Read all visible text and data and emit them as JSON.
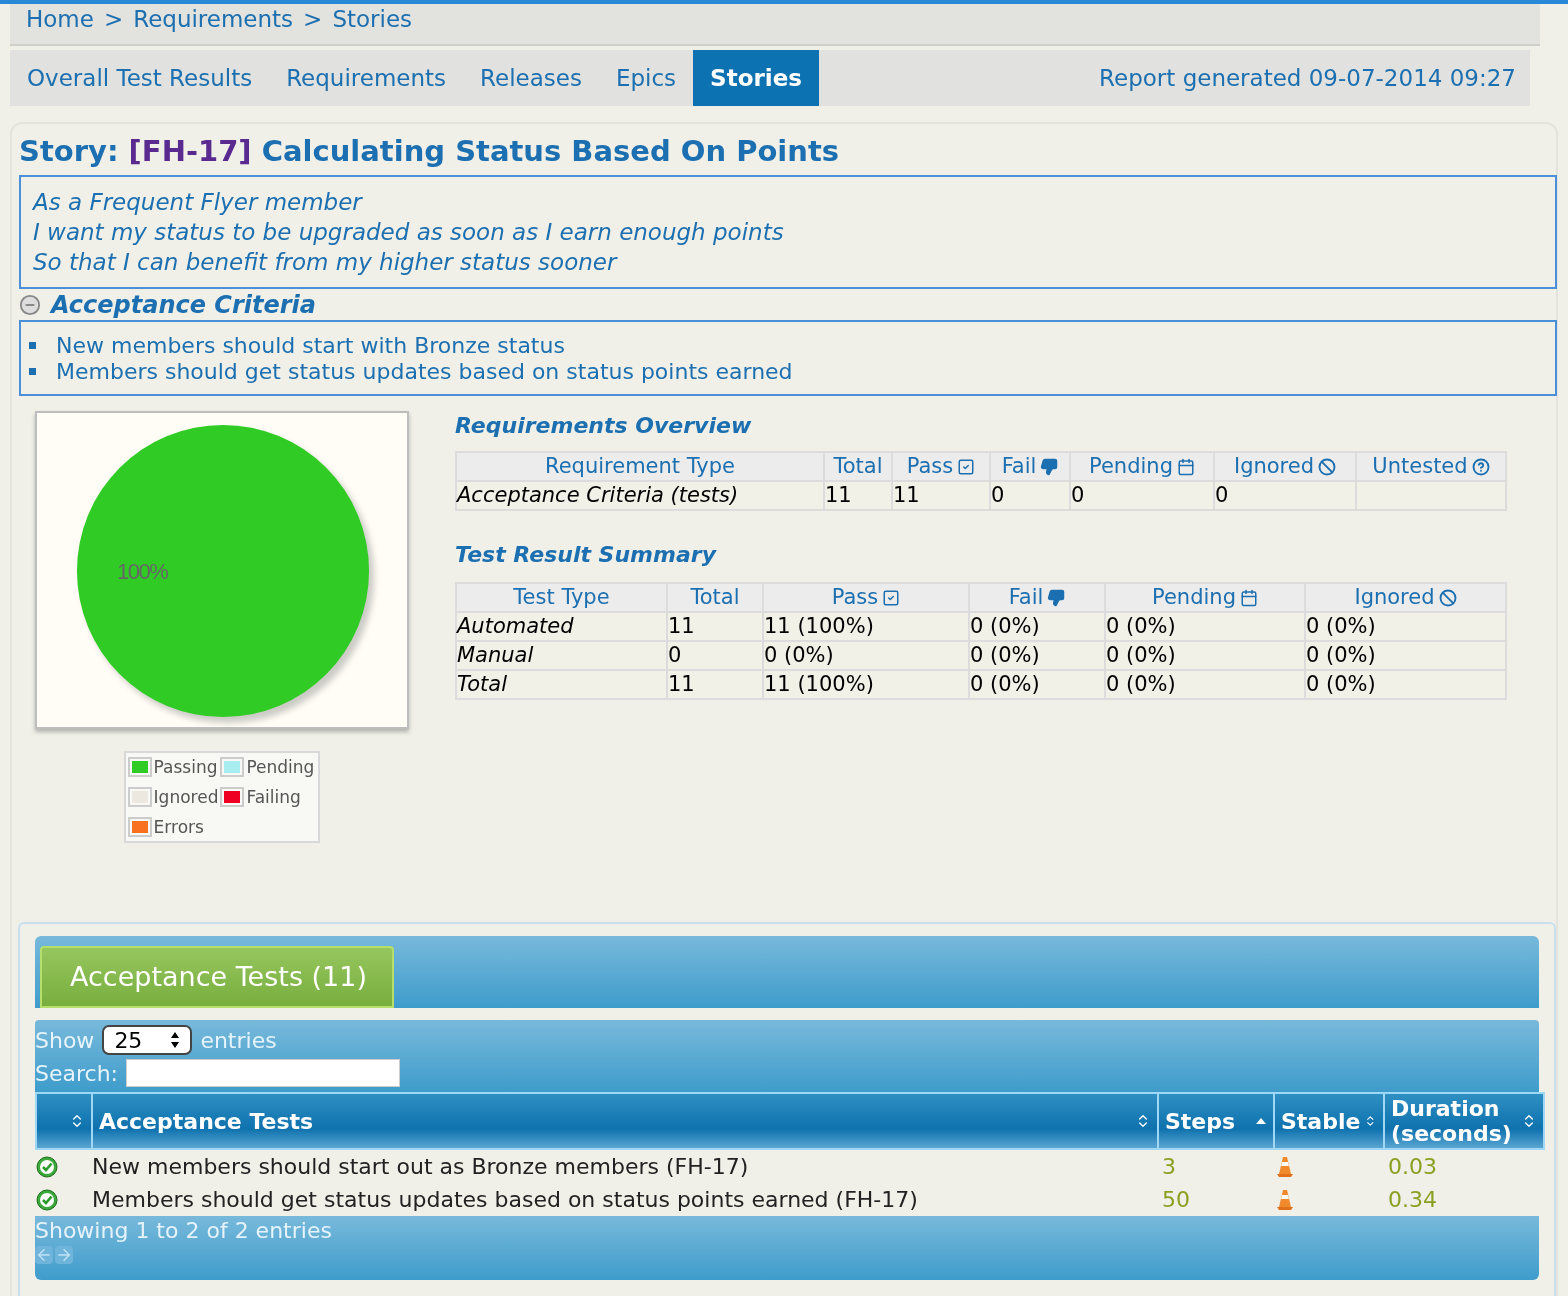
{
  "breadcrumb": [
    "Home",
    "Requirements",
    "Stories"
  ],
  "breadcrumb_separator": ">",
  "nav": {
    "tabs": [
      {
        "label": "Overall Test Results",
        "selected": false
      },
      {
        "label": "Requirements",
        "selected": false
      },
      {
        "label": "Releases",
        "selected": false
      },
      {
        "label": "Epics",
        "selected": false
      },
      {
        "label": "Stories",
        "selected": true
      }
    ],
    "report_generated": "Report generated 09-07-2014 09:27"
  },
  "story": {
    "prefix": "Story:",
    "key": "[FH-17]",
    "title": "Calculating Status Based On Points",
    "narrative": [
      "As a Frequent Flyer member",
      "I want my status to be upgraded as soon as I earn enough points",
      "So that I can benefit from my higher status sooner"
    ],
    "acceptance_criteria": {
      "title": "Acceptance Criteria",
      "expanded": true,
      "items": [
        "New members should start with Bronze status",
        "Members should get status updates based on status points earned"
      ]
    }
  },
  "pie": {
    "chart_data": {
      "type": "pie",
      "categories": [
        "Passing",
        "Pending",
        "Ignored",
        "Failing",
        "Errors"
      ],
      "values": [
        100,
        0,
        0,
        0,
        0
      ],
      "value_labels": [
        "100%",
        null,
        null,
        null,
        null
      ]
    },
    "legend": [
      {
        "color": "#30cc25"
      },
      {
        "color": "#a8eef0"
      },
      {
        "color": "#ece8e0"
      },
      {
        "color": "#ee0022"
      },
      {
        "color": "#f87020"
      }
    ]
  },
  "requirements_overview": {
    "title": "Requirements Overview",
    "columns": [
      {
        "label": "Requirement Type",
        "kind": "plain"
      },
      {
        "label": "Total",
        "kind": "plain"
      },
      {
        "label": "Pass",
        "kind": "pass"
      },
      {
        "label": "Fail",
        "kind": "fail"
      },
      {
        "label": "Pending",
        "kind": "pending"
      },
      {
        "label": "Ignored",
        "kind": "ignored"
      },
      {
        "label": "Untested",
        "kind": "untested"
      }
    ],
    "rows": [
      {
        "cells": [
          "Acceptance Criteria (tests)",
          "11",
          "11",
          "0",
          "0",
          "0",
          ""
        ]
      }
    ]
  },
  "test_result_summary": {
    "title": "Test Result Summary",
    "columns": [
      {
        "label": "Test Type",
        "kind": "plain"
      },
      {
        "label": "Total",
        "kind": "plain"
      },
      {
        "label": "Pass",
        "kind": "pass"
      },
      {
        "label": "Fail",
        "kind": "fail"
      },
      {
        "label": "Pending",
        "kind": "pending"
      },
      {
        "label": "Ignored",
        "kind": "ignored"
      }
    ],
    "rows": [
      {
        "cells": [
          "Automated",
          "11",
          "11 (100%)",
          "0 (0%)",
          "0 (0%)",
          "0 (0%)"
        ]
      },
      {
        "cells": [
          "Manual",
          "0",
          "0 (0%)",
          "0 (0%)",
          "0 (0%)",
          "0 (0%)"
        ]
      },
      {
        "cells": [
          "Total",
          "11",
          "11 (100%)",
          "0 (0%)",
          "0 (0%)",
          "0 (0%)"
        ]
      }
    ]
  },
  "acceptance_tests": {
    "tab": {
      "label": "Acceptance Tests (11)",
      "selected": true
    },
    "show_label": "Show",
    "page_size": "25",
    "entries_label": "entries",
    "search_label": "Search:",
    "columns": [
      {
        "kind": "sortable"
      },
      {
        "label": "Acceptance Tests",
        "kind": "sortable"
      },
      {
        "label": "Steps",
        "kind": "sorted-ascending"
      },
      {
        "label": "Stable",
        "kind": "sortable"
      },
      {
        "label": "Duration (seconds)",
        "kind": "sortable"
      }
    ],
    "rows": [
      {
        "title": "New members should start out as Bronze members (FH-17)",
        "steps": "3",
        "duration": "0.03"
      },
      {
        "title": "Members should get status updates based on status points earned (FH-17)",
        "steps": "50",
        "duration": "0.34"
      }
    ],
    "info": "Showing 1 to 2 of 2 entries"
  }
}
